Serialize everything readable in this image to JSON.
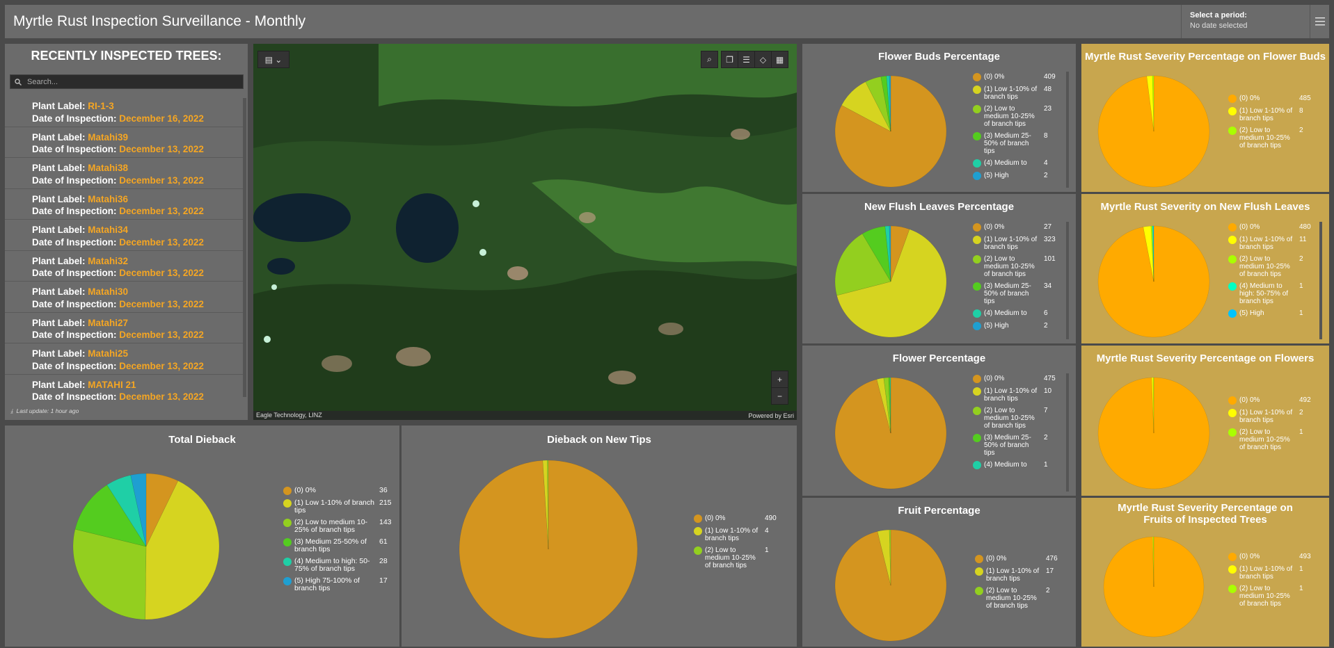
{
  "header": {
    "title": "Myrtle Rust Inspection Surveillance - Monthly",
    "period_label": "Select a period:",
    "period_value": "No date selected"
  },
  "list": {
    "title": "RECENTLY INSPECTED TREES:",
    "search_placeholder": "Search...",
    "label_prefix": "Plant Label:",
    "date_prefix": "Date of Inspection:",
    "items": [
      {
        "label": "RI-1-3",
        "date": "December 16, 2022"
      },
      {
        "label": "Matahi39",
        "date": "December 13, 2022"
      },
      {
        "label": "Matahi38",
        "date": "December 13, 2022"
      },
      {
        "label": "Matahi36",
        "date": "December 13, 2022"
      },
      {
        "label": "Matahi34",
        "date": "December 13, 2022"
      },
      {
        "label": "Matahi32",
        "date": "December 13, 2022"
      },
      {
        "label": "Matahi30",
        "date": "December 13, 2022"
      },
      {
        "label": "Matahi27",
        "date": "December 13, 2022"
      },
      {
        "label": "Matahi25",
        "date": "December 13, 2022"
      },
      {
        "label": "MATAHI 21",
        "date": "December 13, 2022"
      }
    ],
    "last_update": "Last update: 1 hour ago"
  },
  "map": {
    "attribution": "Eagle Technology, LINZ",
    "powered": "Powered by Esri"
  },
  "colors": {
    "c0": "#d4951f",
    "c1": "#d6d420",
    "c2": "#93cf1f",
    "c3": "#54cc1f",
    "c4": "#1fcfa6",
    "c5": "#1f9fd1",
    "g0": "#ffaa00",
    "g1": "#ffff00",
    "g2": "#aaff00",
    "g4": "#00ffc3",
    "g5": "#00c3ff"
  },
  "chart_data": [
    {
      "id": "flower-buds",
      "type": "pie",
      "title": "Flower Buds Percentage",
      "categories": [
        "(0) 0%",
        "(1) Low 1-10% of branch tips",
        "(2) Low to medium 10-25% of branch tips",
        "(3) Medium 25-50% of branch tips",
        "(4) Medium to",
        "(5) High"
      ],
      "values": [
        409,
        48,
        23,
        8,
        4,
        2
      ]
    },
    {
      "id": "new-flush",
      "type": "pie",
      "title": "New Flush Leaves Percentage",
      "categories": [
        "(0) 0%",
        "(1) Low 1-10% of branch tips",
        "(2) Low to medium 10-25% of branch tips",
        "(3) Medium 25-50% of branch tips",
        "(4) Medium to",
        "(5) High"
      ],
      "values": [
        27,
        323,
        101,
        34,
        6,
        2
      ]
    },
    {
      "id": "flower",
      "type": "pie",
      "title": "Flower Percentage",
      "categories": [
        "(0) 0%",
        "(1) Low 1-10% of branch tips",
        "(2) Low to medium 10-25% of branch tips",
        "(3) Medium 25-50% of branch tips",
        "(4) Medium to"
      ],
      "values": [
        475,
        10,
        7,
        2,
        1
      ]
    },
    {
      "id": "fruit",
      "type": "pie",
      "title": "Fruit Percentage",
      "categories": [
        "(0) 0%",
        "(1) Low 1-10% of branch tips",
        "(2) Low to medium 10-25% of branch tips"
      ],
      "values": [
        476,
        17,
        2
      ]
    },
    {
      "id": "sev-buds",
      "type": "pie",
      "title": "Myrtle Rust Severity Percentage on Flower Buds",
      "categories": [
        "(0) 0%",
        "(1) Low 1-10% of branch tips",
        "(2) Low to medium 10-25% of branch tips"
      ],
      "values": [
        485,
        8,
        2
      ]
    },
    {
      "id": "sev-flush",
      "type": "pie",
      "title": "Myrtle Rust Severity on New Flush Leaves",
      "categories": [
        "(0) 0%",
        "(1) Low 1-10% of branch tips",
        "(2) Low to medium 10-25% of branch tips",
        "(4) Medium to high: 50-75% of branch tips",
        "(5) High"
      ],
      "values": [
        480,
        11,
        2,
        1,
        1
      ]
    },
    {
      "id": "sev-flowers",
      "type": "pie",
      "title": "Myrtle Rust Severity Percentage on Flowers",
      "categories": [
        "(0) 0%",
        "(1) Low 1-10% of branch tips",
        "(2) Low to medium 10-25% of branch tips"
      ],
      "values": [
        492,
        2,
        1
      ]
    },
    {
      "id": "sev-fruits",
      "type": "pie",
      "title": "Myrtle Rust Severity Percentage on Fruits of Inspected Trees",
      "categories": [
        "(0) 0%",
        "(1) Low 1-10% of branch tips",
        "(2) Low to medium 10-25% of branch tips"
      ],
      "values": [
        493,
        1,
        1
      ]
    },
    {
      "id": "total-dieback",
      "type": "pie",
      "title": "Total Dieback",
      "categories": [
        "(0) 0%",
        "(1) Low 1-10% of branch tips",
        "(2) Low to medium 10-25% of branch tips",
        "(3) Medium 25-50% of branch tips",
        "(4) Medium to high: 50-75% of branch tips",
        "(5) High 75-100% of branch tips"
      ],
      "values": [
        36,
        215,
        143,
        61,
        28,
        17
      ]
    },
    {
      "id": "dieback-new-tips",
      "type": "pie",
      "title": "Dieback on New Tips",
      "categories": [
        "(0) 0%",
        "(1) Low 1-10% of branch tips",
        "(2) Low to medium 10-25% of branch tips"
      ],
      "values": [
        490,
        4,
        1
      ]
    }
  ]
}
